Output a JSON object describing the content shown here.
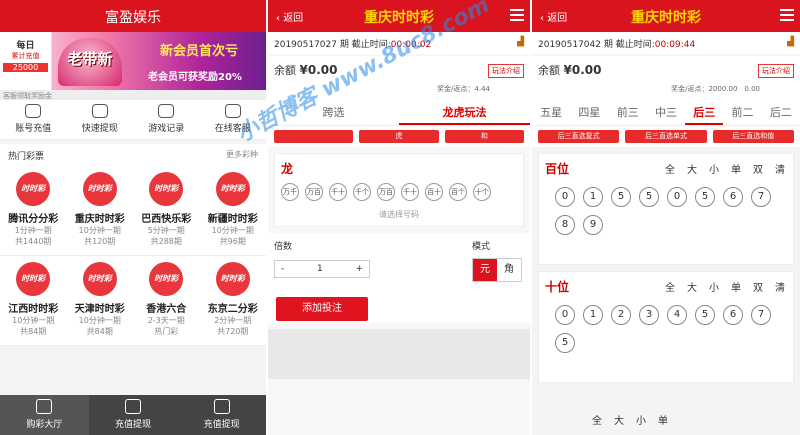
{
  "panel1": {
    "title": "富盈娱乐",
    "banner": {
      "side_title": "每日",
      "side_label": "累计充值",
      "side_amount": "25000",
      "main_text": "老带新",
      "line1": "新会员首次亏",
      "line2": "老会员可获奖励20%",
      "note": "客服领取奖励金"
    },
    "quick_actions": [
      {
        "label": "账号充值",
        "icon": "deposit-icon"
      },
      {
        "label": "快速提现",
        "icon": "wallet-icon"
      },
      {
        "label": "游戏记录",
        "icon": "record-icon"
      },
      {
        "label": "在线客服",
        "icon": "service-icon"
      }
    ],
    "section_title": "热门彩票",
    "section_more": "更多彩种",
    "lottery_logo": "时时彩",
    "lotteries": [
      {
        "name": "腾讯分分彩",
        "sub1": "1分钟一期",
        "sub2": "共1440期"
      },
      {
        "name": "重庆时时彩",
        "sub1": "10分钟一期",
        "sub2": "共120期"
      },
      {
        "name": "巴西快乐彩",
        "sub1": "5分钟一期",
        "sub2": "共288期"
      },
      {
        "name": "新疆时时彩",
        "sub1": "10分钟一期",
        "sub2": "共96期"
      },
      {
        "name": "江西时时彩",
        "sub1": "10分钟一期",
        "sub2": "共84期"
      },
      {
        "name": "天津时时彩",
        "sub1": "10分钟一期",
        "sub2": "共84期"
      },
      {
        "name": "香港六合",
        "sub1": "2-3天一期",
        "sub2": "热门彩"
      },
      {
        "name": "东京二分彩",
        "sub1": "2分钟一期",
        "sub2": "共720期"
      }
    ],
    "tabbar": [
      {
        "label": "购彩大厅",
        "icon": "home-icon",
        "active": true
      },
      {
        "label": "充值提现",
        "icon": "money-bag-icon",
        "active": false
      },
      {
        "label": "充值提现",
        "icon": "money-bag-icon",
        "active": false
      }
    ]
  },
  "panel2": {
    "back": "返回",
    "title": "重庆时时彩",
    "issue": "20190517027 期",
    "deadline_label": "截止时间:",
    "deadline": "00:00:02",
    "balance_label": "余额",
    "balance": "¥0.00",
    "rebate": "奖金/返点：4.44",
    "intro": "玩法介绍",
    "tabs": [
      "跨选",
      "龙虎玩法"
    ],
    "sub_buttons": [
      "",
      "虎",
      "和"
    ],
    "area_title": "龙",
    "positions": [
      "万千",
      "万百",
      "千十",
      "千个",
      "万百",
      "千十",
      "百十",
      "百个",
      "十个"
    ],
    "hint": "请选择号码",
    "multiple_label": "倍数",
    "multiple_value": "1",
    "minus": "-",
    "plus": "+",
    "mode_label": "模式",
    "mode_options": [
      "元",
      "角"
    ],
    "add_button": "添加投注"
  },
  "panel3": {
    "back": "返回",
    "title": "重庆时时彩",
    "issue": "20190517042 期",
    "deadline_label": "截止时间:",
    "deadline": "00:09:44",
    "balance_label": "余额",
    "balance": "¥0.00",
    "rebate": "奖金/返点：2000.00　0.00",
    "intro": "玩法介绍",
    "tabs": [
      "五星",
      "四星",
      "前三",
      "中三",
      "后三",
      "前二",
      "后二"
    ],
    "active_tab": 4,
    "sub_buttons": [
      "后三直选复式",
      "后三直选单式",
      "后三直选和值"
    ],
    "ops": [
      "全",
      "大",
      "小",
      "单",
      "双",
      "清"
    ],
    "digits": [
      {
        "title": "百位",
        "numbers": [
          "0",
          "1",
          "5",
          "5",
          "0",
          "5",
          "6",
          "7",
          "8",
          "9"
        ]
      },
      {
        "title": "十位",
        "numbers": [
          "0",
          "1",
          "2",
          "3",
          "4",
          "5",
          "6",
          "7",
          "5"
        ]
      }
    ],
    "bottom_ops": [
      "全",
      "大",
      "小",
      "单"
    ]
  },
  "watermark": "小哲博客 www.8uc8.com"
}
